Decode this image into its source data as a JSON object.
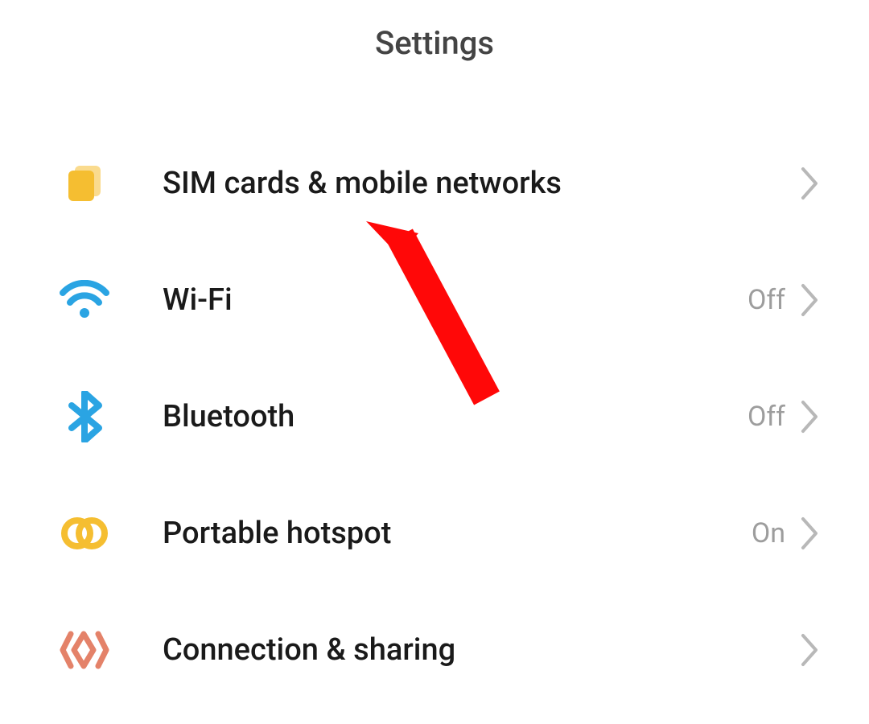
{
  "header": {
    "title": "Settings"
  },
  "items": [
    {
      "icon": "sim-cards-icon",
      "label": "SIM cards & mobile networks",
      "value": ""
    },
    {
      "icon": "wifi-icon",
      "label": "Wi-Fi",
      "value": "Off"
    },
    {
      "icon": "bluetooth-icon",
      "label": "Bluetooth",
      "value": "Off"
    },
    {
      "icon": "hotspot-icon",
      "label": "Portable hotspot",
      "value": "On"
    },
    {
      "icon": "sharing-icon",
      "label": "Connection & sharing",
      "value": ""
    }
  ],
  "colors": {
    "yellow": "#F5BE31",
    "blue": "#2AA4E3",
    "salmon": "#E48269",
    "grey": "#A0A0A0",
    "arrow": "#FF0808"
  }
}
